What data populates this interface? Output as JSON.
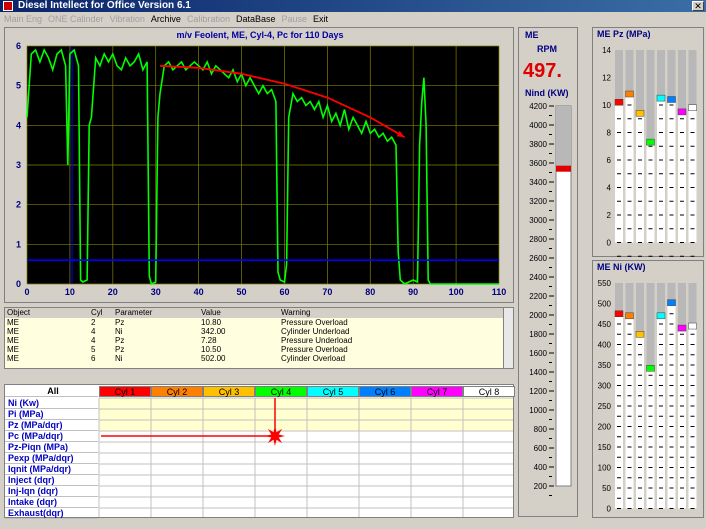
{
  "window": {
    "title": "Diesel Intellect for Office     Version 6.1",
    "close_label": "✕"
  },
  "menu": [
    {
      "label": "Main Eng",
      "enabled": false
    },
    {
      "label": "ONE Calinder",
      "enabled": false
    },
    {
      "label": "Vibration",
      "enabled": false
    },
    {
      "label": "Archive",
      "enabled": true
    },
    {
      "label": "Calibration",
      "enabled": false
    },
    {
      "label": "DataBase",
      "enabled": true
    },
    {
      "label": "Pause",
      "enabled": false
    },
    {
      "label": "Exit",
      "enabled": true
    }
  ],
  "chart_data": {
    "type": "line",
    "title": "m/v Feolent,  ME,  Cyl-4,  Pc  for 110 Days",
    "xlim": [
      0,
      110
    ],
    "ylim": [
      0,
      6
    ],
    "xticks": [
      0,
      10,
      20,
      30,
      40,
      50,
      60,
      70,
      80,
      90,
      100,
      110
    ],
    "yticks": [
      0,
      1,
      2,
      3,
      4,
      5,
      6
    ],
    "grid": true,
    "background": "#000000",
    "gridcolor": "#808000",
    "series": [
      {
        "color": "#00ff00",
        "points": [
          [
            0,
            4.2
          ],
          [
            1,
            5.8
          ],
          [
            2,
            5.9
          ],
          [
            3,
            5.6
          ],
          [
            4,
            5.9
          ],
          [
            5,
            5.7
          ],
          [
            6,
            5.4
          ],
          [
            7,
            5.8
          ],
          [
            8,
            5.9
          ],
          [
            9,
            5.5
          ],
          [
            9.5,
            3.0
          ],
          [
            10,
            5.8
          ],
          [
            11,
            5.9
          ],
          [
            12,
            5.5
          ],
          [
            12.5,
            0.1
          ],
          [
            13,
            0.05
          ],
          [
            14,
            0.1
          ],
          [
            14.5,
            4.0
          ],
          [
            15,
            4.2
          ],
          [
            16,
            5.7
          ],
          [
            17,
            5.5
          ],
          [
            18,
            5.8
          ],
          [
            19,
            5.6
          ],
          [
            20,
            5.8
          ],
          [
            21,
            5.5
          ],
          [
            22,
            5.4
          ],
          [
            23,
            5.7
          ],
          [
            24,
            5.5
          ],
          [
            25,
            5.6
          ],
          [
            26,
            5.8
          ],
          [
            27,
            5.4
          ],
          [
            28,
            5.6
          ],
          [
            28.5,
            0.2
          ],
          [
            29,
            0.0
          ],
          [
            30,
            0.05
          ],
          [
            30.5,
            4.2
          ],
          [
            31,
            4.8
          ],
          [
            32,
            5.5
          ],
          [
            33,
            5.6
          ],
          [
            34,
            5.4
          ],
          [
            35,
            5.5
          ],
          [
            36,
            5.6
          ],
          [
            37,
            5.4
          ],
          [
            38,
            5.5
          ],
          [
            39,
            5.6
          ],
          [
            40,
            5.5
          ],
          [
            41,
            5.4
          ],
          [
            42,
            5.6
          ],
          [
            43,
            5.3
          ],
          [
            44,
            5.5
          ],
          [
            45,
            5.4
          ],
          [
            46,
            5.3
          ],
          [
            47,
            5.2
          ],
          [
            48,
            5.4
          ],
          [
            49,
            5.1
          ],
          [
            50,
            5.3
          ],
          [
            51,
            5.0
          ],
          [
            52,
            5.2
          ],
          [
            53,
            5.0
          ],
          [
            54,
            4.8
          ],
          [
            55,
            5.0
          ],
          [
            56,
            4.8
          ],
          [
            57,
            4.9
          ],
          [
            58,
            4.6
          ],
          [
            58.5,
            0.3
          ],
          [
            59,
            0.1
          ],
          [
            60,
            0.05
          ],
          [
            60.5,
            0.5
          ],
          [
            61,
            4.2
          ],
          [
            62,
            4.8
          ],
          [
            63,
            4.6
          ],
          [
            64,
            4.7
          ],
          [
            65,
            4.5
          ],
          [
            66,
            4.6
          ],
          [
            67,
            4.4
          ],
          [
            68,
            4.6
          ],
          [
            69,
            4.2
          ],
          [
            70,
            4.5
          ],
          [
            71,
            4.1
          ],
          [
            72,
            4.3
          ],
          [
            73,
            4.0
          ],
          [
            74,
            4.4
          ],
          [
            75,
            3.9
          ],
          [
            76,
            4.2
          ],
          [
            77,
            4.0
          ],
          [
            78,
            3.8
          ],
          [
            79,
            4.1
          ],
          [
            80,
            3.8
          ],
          [
            81,
            3.9
          ],
          [
            82,
            3.7
          ],
          [
            83,
            3.8
          ],
          [
            84,
            3.6
          ],
          [
            85,
            3.7
          ],
          [
            86,
            3.5
          ],
          [
            86.5,
            0.8
          ],
          [
            87,
            0.1
          ],
          [
            88,
            0.0
          ],
          [
            89,
            0.05
          ],
          [
            90,
            0.1
          ],
          [
            91,
            0.05
          ],
          [
            91.5,
            3.5
          ],
          [
            92,
            4.6
          ],
          [
            92.5,
            5.2
          ],
          [
            93,
            4.0
          ],
          [
            93.5,
            0.1
          ],
          [
            94,
            0.0
          ],
          [
            110,
            0.0
          ]
        ]
      },
      {
        "color": "#0000ff",
        "points": [
          [
            0,
            0.6
          ],
          [
            110,
            0.6
          ]
        ]
      },
      {
        "color": "#ff0000",
        "points": [
          [
            31,
            5.5
          ],
          [
            40,
            5.45
          ],
          [
            50,
            5.3
          ],
          [
            60,
            5.05
          ],
          [
            70,
            4.7
          ],
          [
            80,
            4.2
          ],
          [
            88,
            3.7
          ]
        ]
      }
    ],
    "vline_x": 10.5
  },
  "warnings": {
    "headers": [
      "Object",
      "Cyl",
      "Parameter",
      "Value",
      "Warning"
    ],
    "rows": [
      [
        "ME",
        "2",
        "Pz",
        "10.80",
        "Pressure Overload"
      ],
      [
        "ME",
        "4",
        "Ni",
        "342.00",
        "Cylinder Underload"
      ],
      [
        "ME",
        "4",
        "Pz",
        "7.28",
        "Pressure Underload"
      ],
      [
        "ME",
        "5",
        "Pz",
        "10.50",
        "Pressure Overload"
      ],
      [
        "ME",
        "6",
        "Ni",
        "502.00",
        "Cylinder Overload"
      ]
    ]
  },
  "grid": {
    "all_label": "All",
    "cylinders": [
      {
        "label": "Cyl 1",
        "color": "#ff0000"
      },
      {
        "label": "Cyl 2",
        "color": "#ff8000"
      },
      {
        "label": "Cyl 3",
        "color": "#ffc000"
      },
      {
        "label": "Cyl 4",
        "color": "#00ff00"
      },
      {
        "label": "Cyl 5",
        "color": "#00ffff"
      },
      {
        "label": "Cyl 6",
        "color": "#0080ff"
      },
      {
        "label": "Cyl 7",
        "color": "#ff00ff"
      },
      {
        "label": "Cyl 8",
        "color": "#ffffff"
      }
    ],
    "params": [
      "Ni    (Kw)",
      "Pi    (MPa)",
      "Pz    (MPa/dqr)",
      "Pc    (MPa/dqr)",
      "Pz-Piqn    (MPa)",
      "Pexp    (MPa/dqr)",
      "Iqnit  (MPa/dqr)",
      "Inject (dqr)",
      "Inj-Iqn  (dqr)",
      "Intake (dqr)",
      "Exhaust(dqr)"
    ]
  },
  "me_panel": {
    "title": "ME",
    "rpm_label": "RPM",
    "rpm_value": "497.",
    "nind_label": "Nind (KW)",
    "scale": [
      "4200",
      "4000",
      "3800",
      "3600",
      "3400",
      "3200",
      "3000",
      "2800",
      "2600",
      "2400",
      "2200",
      "2000",
      "1800",
      "1600",
      "1400",
      "1200",
      "1000",
      "800",
      "600",
      "400",
      "200"
    ],
    "indicator_value": 3540,
    "scale_min": 200,
    "scale_max": 4200
  },
  "pz_panel": {
    "title": "ME Pz  (MPa)",
    "scale": [
      "14",
      "12",
      "10",
      "8",
      "6",
      "4",
      "2",
      "0"
    ],
    "scale_min": 0,
    "scale_max": 14,
    "values": [
      10.2,
      10.8,
      9.4,
      7.3,
      10.5,
      10.4,
      9.5,
      9.8
    ]
  },
  "ni_panel": {
    "title": "ME Ni  (KW)",
    "scale": [
      "550",
      "500",
      "450",
      "400",
      "350",
      "300",
      "250",
      "200",
      "150",
      "100",
      "50",
      "0"
    ],
    "scale_min": 0,
    "scale_max": 550,
    "values": [
      475,
      470,
      425,
      342,
      470,
      502,
      440,
      445
    ]
  }
}
